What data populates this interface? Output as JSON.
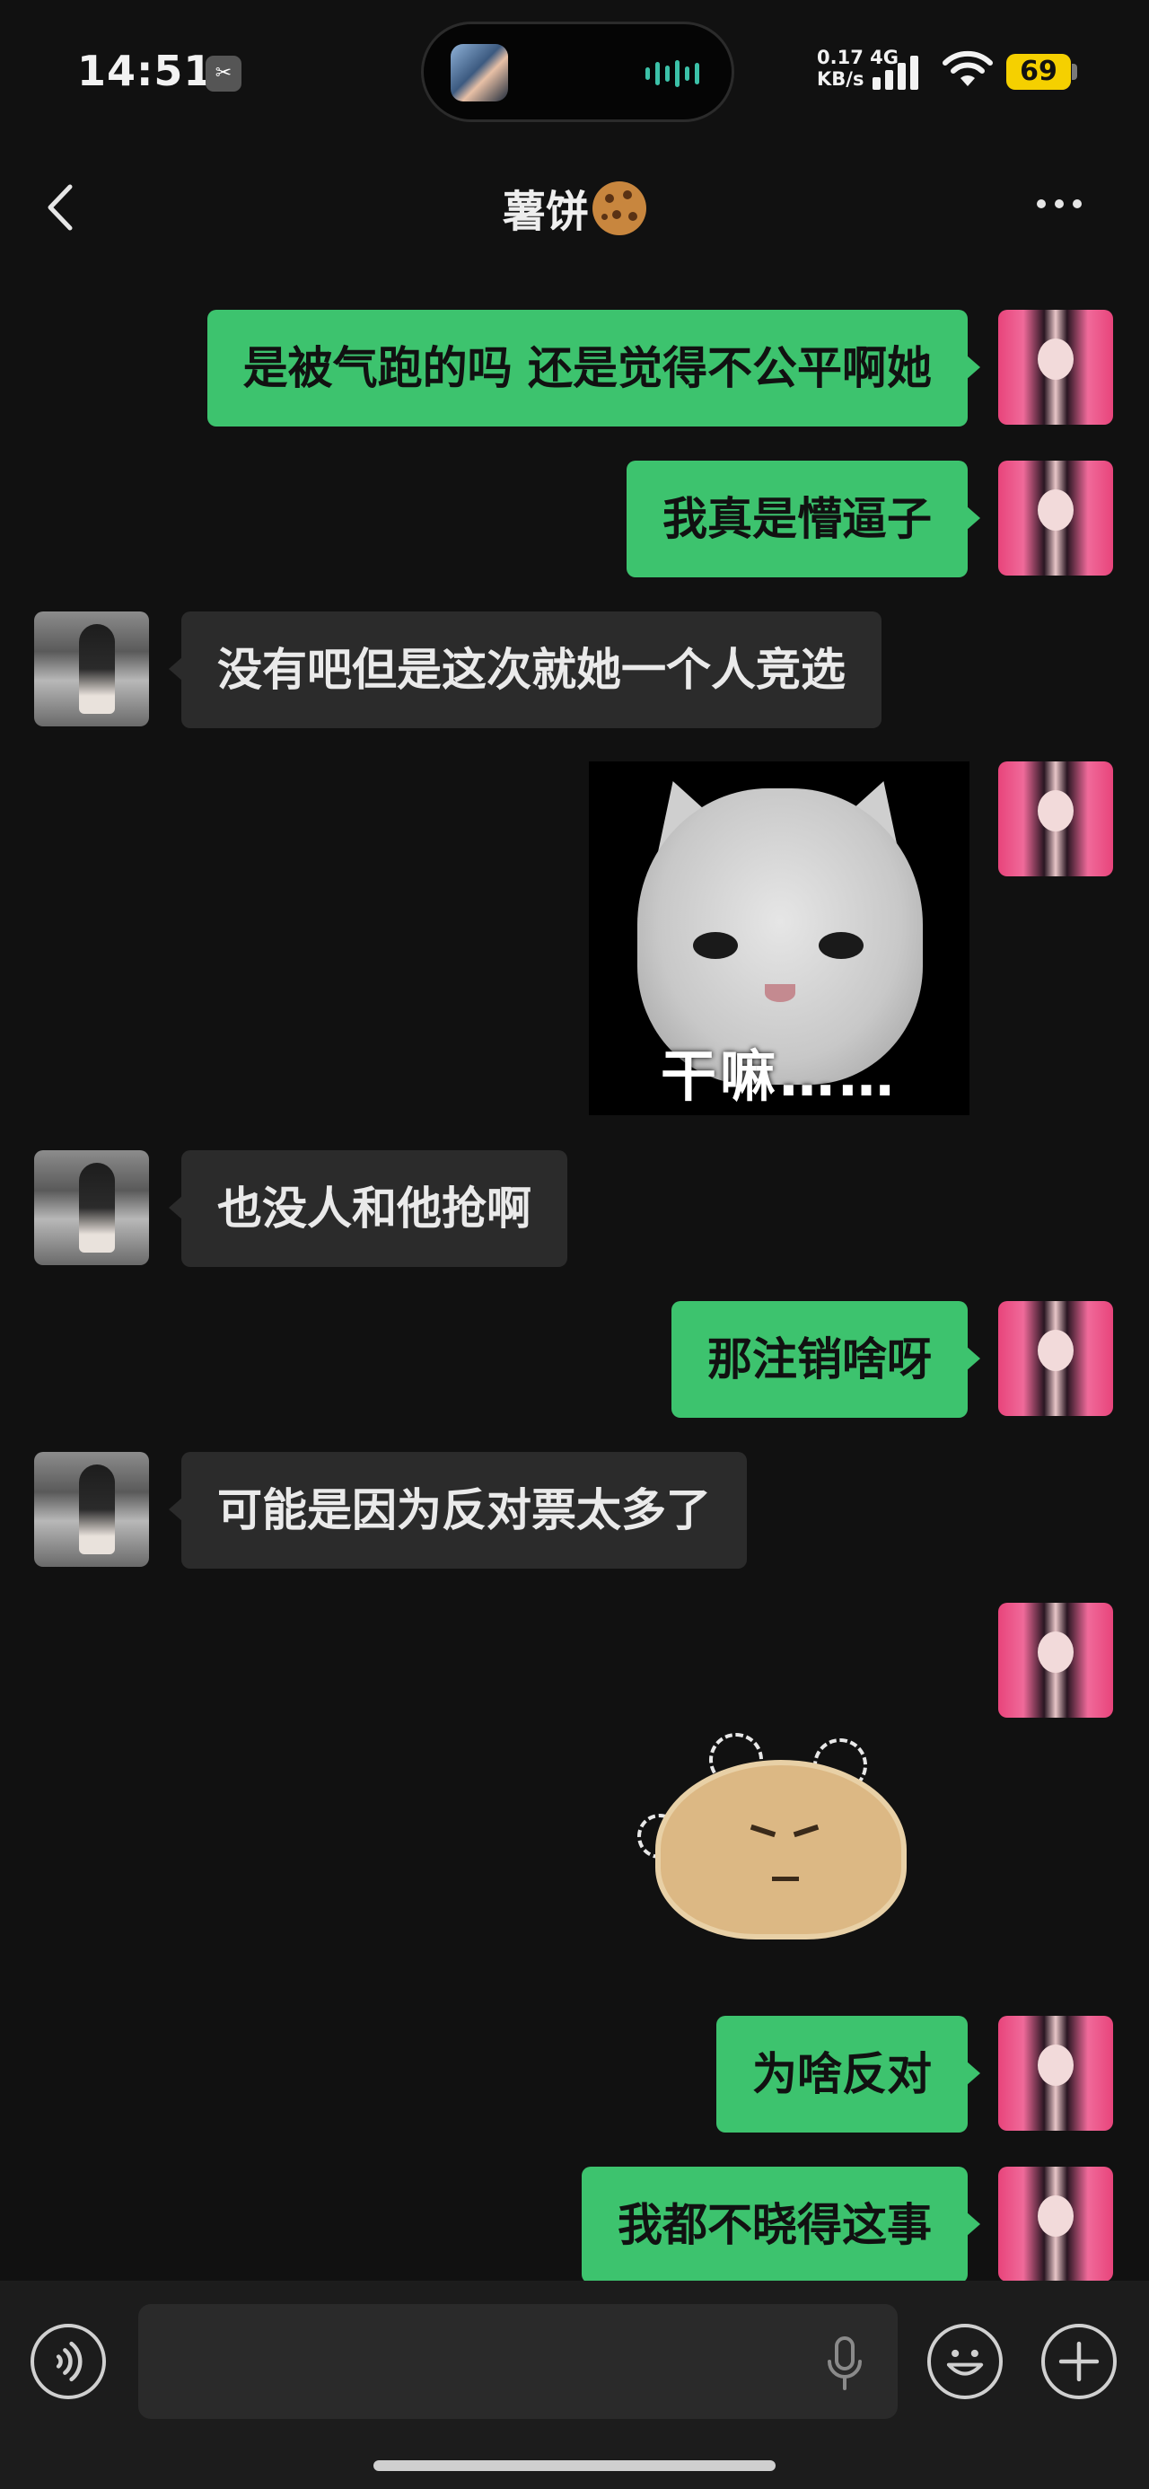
{
  "status_bar": {
    "time": "14:51",
    "app_indicator_icon": "capcut-icon",
    "network_speed_value": "0.17",
    "network_speed_unit": "KB/s",
    "network_type": "4G",
    "battery_level": "69",
    "wifi_icon": "wifi-icon",
    "signal_icon": "cellular-signal-icon"
  },
  "header": {
    "title": "薯饼",
    "title_emoji": "cookie-emoji",
    "back_icon": "chevron-left-icon",
    "more_icon": "more-dots-icon"
  },
  "messages": [
    {
      "sender": "me",
      "type": "text",
      "text": "是被气跑的吗 还是觉得不公平啊她"
    },
    {
      "sender": "me",
      "type": "text",
      "text": "我真是懵逼子"
    },
    {
      "sender": "other",
      "type": "text",
      "text": "没有吧但是这次就她一个人竞选"
    },
    {
      "sender": "me",
      "type": "sticker",
      "sticker": "cat-stare-sticker",
      "caption": "干嘛……"
    },
    {
      "sender": "other",
      "type": "text",
      "text": "也没人和他抢啊"
    },
    {
      "sender": "me",
      "type": "text",
      "text": "那注销啥呀"
    },
    {
      "sender": "other",
      "type": "text",
      "text": "可能是因为反对票太多了"
    },
    {
      "sender": "me",
      "type": "sticker",
      "sticker": "angry-hamster-sticker"
    },
    {
      "sender": "me",
      "type": "text",
      "text": "为啥反对"
    },
    {
      "sender": "me",
      "type": "text",
      "text": "我都不晓得这事"
    }
  ],
  "input_bar": {
    "text_value": "",
    "voice_icon": "voice-mode-icon",
    "mic_icon": "microphone-icon",
    "emoji_icon": "emoji-icon",
    "plus_icon": "plus-icon"
  },
  "colors": {
    "background": "#111111",
    "my_bubble": "#3dc36e",
    "other_bubble": "#2b2b2b",
    "battery": "#f5d000"
  }
}
